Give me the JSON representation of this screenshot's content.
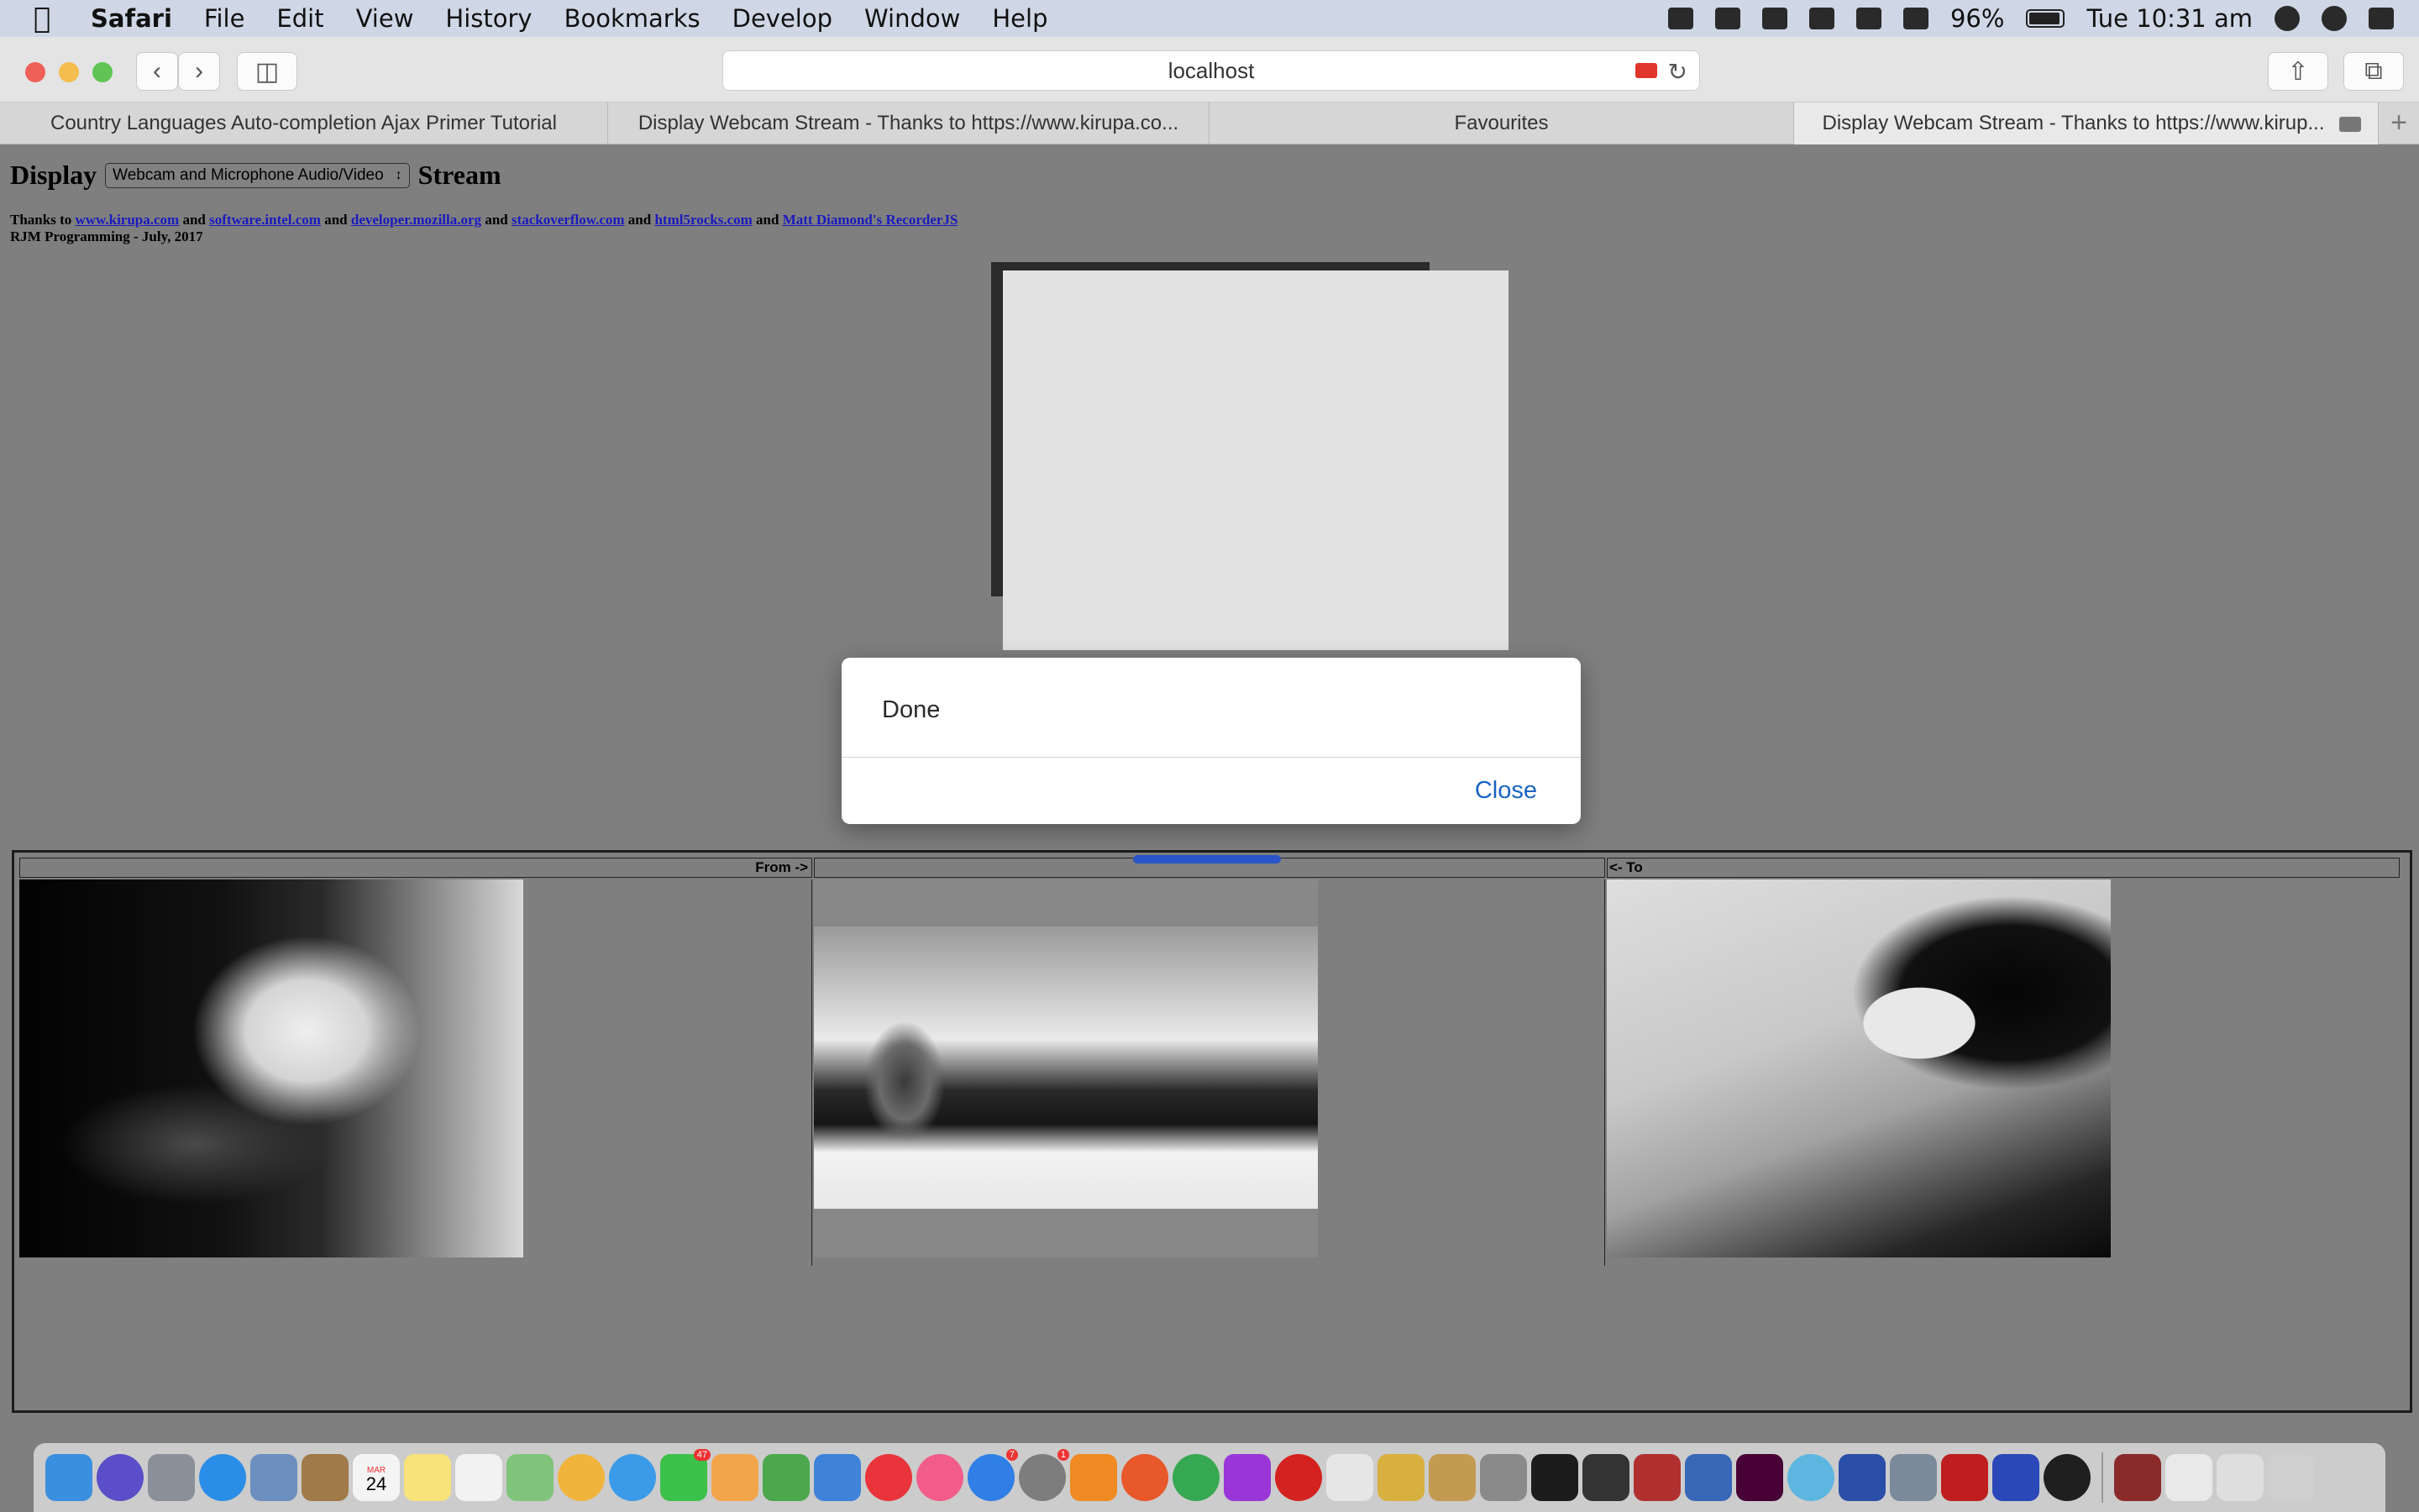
{
  "menubar": {
    "app": "Safari",
    "items": [
      "File",
      "Edit",
      "View",
      "History",
      "Bookmarks",
      "Develop",
      "Window",
      "Help"
    ],
    "battery": "96%",
    "clock": "Tue 10:31 am"
  },
  "toolbar": {
    "url": "localhost"
  },
  "tabs": [
    {
      "title": "Country Languages Auto-completion Ajax Primer Tutorial"
    },
    {
      "title": "Display Webcam Stream - Thanks to https://www.kirupa.co..."
    },
    {
      "title": "Favourites"
    },
    {
      "title": "Display Webcam Stream - Thanks to https://www.kirup..."
    }
  ],
  "page": {
    "heading_left": "Display",
    "select_value": "Webcam and Microphone Audio/Video",
    "heading_right": "Stream",
    "thanks": "Thanks to",
    "links": [
      "www.kirupa.com",
      "software.intel.com",
      "developer.mozilla.org",
      "stackoverflow.com",
      "html5rocks.com",
      "Matt Diamond's RecorderJS"
    ],
    "and": "and",
    "byline": "RJM Programming - July, 2017",
    "from_label": "From ->",
    "to_label": "<- To"
  },
  "modal": {
    "message": "Done",
    "close_label": "Close"
  },
  "dock": {
    "calendar_month": "MAR",
    "calendar_day": "24",
    "badges": {
      "facetime": "47",
      "appstore": "7",
      "prefs": "1"
    }
  },
  "colors": {
    "page_bg": "#7f7f7f",
    "link": "#1a1ac0",
    "modal_button": "#1a64c4",
    "progress": "#2a55c8"
  }
}
